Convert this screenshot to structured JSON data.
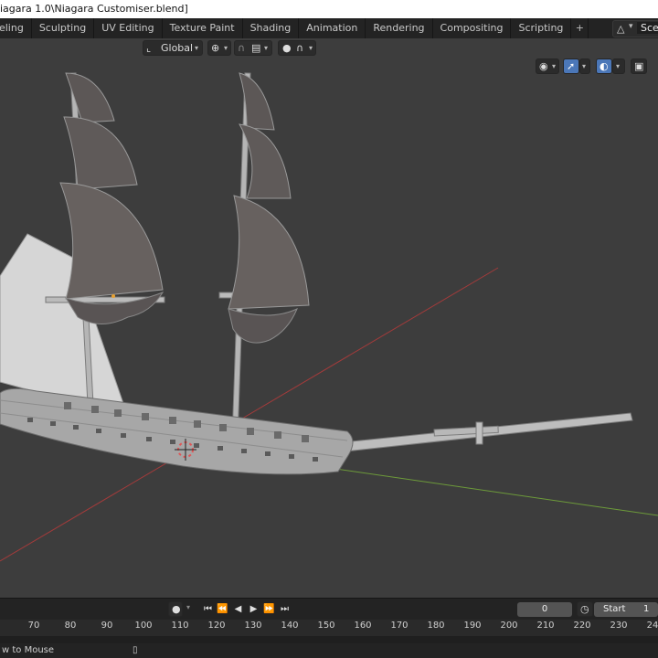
{
  "window": {
    "title": "iagara 1.0\\Niagara Customiser.blend]"
  },
  "workspace_tabs": [
    {
      "label": "deling"
    },
    {
      "label": "Sculpting"
    },
    {
      "label": "UV Editing"
    },
    {
      "label": "Texture Paint"
    },
    {
      "label": "Shading"
    },
    {
      "label": "Animation"
    },
    {
      "label": "Rendering"
    },
    {
      "label": "Compositing"
    },
    {
      "label": "Scripting"
    }
  ],
  "add_workspace_label": "+",
  "scene": {
    "label": "Scen"
  },
  "viewport_header": {
    "orientation_label": "Global",
    "pivot_icon": "transform-pivot-icon",
    "snap_icon": "magnet-icon",
    "proportional_icon": "proportional-edit-icon"
  },
  "viewport_right_icons": [
    "visibility-eye-icon",
    "gizmo-icon",
    "overlay-icon",
    "xray-icon"
  ],
  "colors": {
    "x_axis": "#a33b3b",
    "y_axis": "#6d9b3a",
    "viewport_bg": "#3d3d3d",
    "active_blue": "#4b77b8"
  },
  "timeline": {
    "current_frame": "0",
    "start_label": "Start",
    "start_value": "1"
  },
  "ruler_ticks": [
    "70",
    "80",
    "90",
    "100",
    "110",
    "120",
    "130",
    "140",
    "150",
    "160",
    "170",
    "180",
    "190",
    "200",
    "210",
    "220",
    "230",
    "24"
  ],
  "status": {
    "text": "w to Mouse"
  }
}
